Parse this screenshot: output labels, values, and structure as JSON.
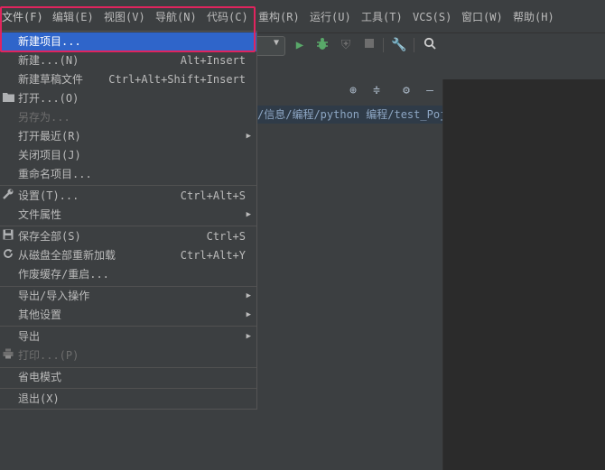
{
  "menubar": {
    "items": [
      {
        "label": "文件(F)"
      },
      {
        "label": "编辑(E)"
      },
      {
        "label": "视图(V)"
      },
      {
        "label": "导航(N)"
      },
      {
        "label": "代码(C)"
      },
      {
        "label": "重构(R)"
      },
      {
        "label": "运行(U)"
      },
      {
        "label": "工具(T)"
      },
      {
        "label": "VCS(S)"
      },
      {
        "label": "窗口(W)"
      },
      {
        "label": "帮助(H)"
      }
    ]
  },
  "project_panel": {
    "path": "/信息/编程/python 编程/test_Pojects"
  },
  "file_menu": {
    "items": [
      {
        "label": "新建项目...",
        "shortcut": ""
      },
      {
        "label": "新建...(N)",
        "shortcut": "Alt+Insert"
      },
      {
        "label": "新建草稿文件",
        "shortcut": "Ctrl+Alt+Shift+Insert"
      },
      {
        "label": "打开...(O)",
        "shortcut": ""
      },
      {
        "label": "另存为...",
        "shortcut": ""
      },
      {
        "label": "打开最近(R)",
        "shortcut": ""
      },
      {
        "label": "关闭项目(J)",
        "shortcut": ""
      },
      {
        "label": "重命名项目...",
        "shortcut": ""
      },
      {
        "label": "设置(T)...",
        "shortcut": "Ctrl+Alt+S"
      },
      {
        "label": "文件属性",
        "shortcut": ""
      },
      {
        "label": "保存全部(S)",
        "shortcut": "Ctrl+S"
      },
      {
        "label": "从磁盘全部重新加载",
        "shortcut": "Ctrl+Alt+Y"
      },
      {
        "label": "作废缓存/重启...",
        "shortcut": ""
      },
      {
        "label": "导出/导入操作",
        "shortcut": ""
      },
      {
        "label": "其他设置",
        "shortcut": ""
      },
      {
        "label": "导出",
        "shortcut": ""
      },
      {
        "label": "打印...(P)",
        "shortcut": ""
      },
      {
        "label": "省电模式",
        "shortcut": ""
      },
      {
        "label": "退出(X)",
        "shortcut": ""
      }
    ]
  },
  "colors": {
    "selection": "#2f65ca",
    "highlight_border": "#e0245e",
    "run_green": "#59a869"
  }
}
